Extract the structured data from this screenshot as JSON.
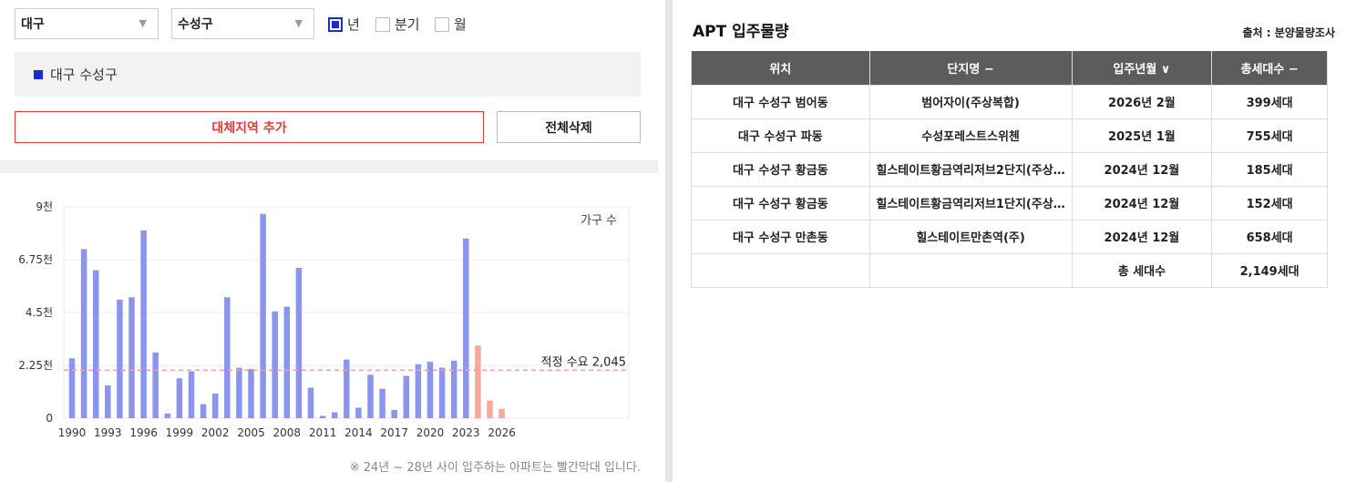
{
  "filters": {
    "city": "대구",
    "district": "수성구",
    "periods": [
      {
        "label": "년",
        "checked": true
      },
      {
        "label": "분기",
        "checked": false
      },
      {
        "label": "월",
        "checked": false
      }
    ]
  },
  "selected_region": "대구 수성구",
  "buttons": {
    "add": "대체지역 추가",
    "delete_all": "전체삭제"
  },
  "note": "※ 24년 ~ 28년 사이 입주하는 아파트는 빨간막대 입니다.",
  "colors": {
    "past_bar": "#8b95ee",
    "future_bar": "#f9a999",
    "demand_line": "#f5a0a8",
    "accent_blue": "#1b2ad9",
    "accent_red": "#e23a3a",
    "header_gray": "#5c5c5c"
  },
  "chart_data": {
    "type": "bar",
    "series_label": "가구 수",
    "x": [
      1990,
      1991,
      1992,
      1993,
      1994,
      1995,
      1996,
      1997,
      1998,
      1999,
      2000,
      2001,
      2002,
      2003,
      2004,
      2005,
      2006,
      2007,
      2008,
      2009,
      2010,
      2011,
      2012,
      2013,
      2014,
      2015,
      2016,
      2017,
      2018,
      2019,
      2020,
      2021,
      2022,
      2023,
      2024,
      2025,
      2026
    ],
    "values": [
      2550,
      7200,
      6300,
      1400,
      5050,
      5150,
      8000,
      2800,
      200,
      1700,
      2000,
      600,
      1050,
      5150,
      2150,
      2100,
      8700,
      4550,
      4750,
      6400,
      1300,
      100,
      250,
      2500,
      450,
      1850,
      1250,
      350,
      1800,
      2300,
      2400,
      2150,
      2450,
      7650,
      3100,
      750,
      400
    ],
    "future_from": 2024,
    "x_ticks": [
      1990,
      1993,
      1996,
      1999,
      2002,
      2005,
      2008,
      2011,
      2014,
      2017,
      2020,
      2023,
      2026
    ],
    "y_ticks": [
      0,
      2250,
      4500,
      6750,
      9000
    ],
    "y_tick_labels": [
      "0",
      "2.25천",
      "4.5천",
      "6.75천",
      "9천"
    ],
    "ylim": [
      0,
      9000
    ],
    "reference_line": {
      "value": 2045,
      "label": "적정 수요 2,045"
    }
  },
  "table": {
    "title": "APT 입주물량",
    "source": "출처 : 분양물량조사",
    "headers": [
      "위치",
      "단지명 −",
      "입주년월 ∨",
      "총세대수 −"
    ],
    "rows": [
      [
        "대구 수성구 범어동",
        "범어자이(주상복합)",
        "2026년 2월",
        "399세대"
      ],
      [
        "대구 수성구 파동",
        "수성포레스트스위첸",
        "2025년 1월",
        "755세대"
      ],
      [
        "대구 수성구 황금동",
        "힐스테이트황금역리저브2단지(주상…",
        "2024년 12월",
        "185세대"
      ],
      [
        "대구 수성구 황금동",
        "힐스테이트황금역리저브1단지(주상…",
        "2024년 12월",
        "152세대"
      ],
      [
        "대구 수성구 만촌동",
        "힐스테이트만촌역(주)",
        "2024년 12월",
        "658세대"
      ]
    ],
    "total_label": "총 세대수",
    "total_value": "2,149세대"
  }
}
